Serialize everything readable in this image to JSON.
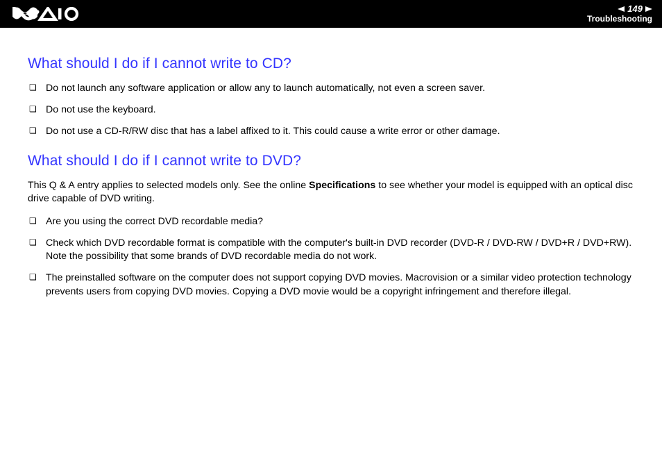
{
  "header": {
    "page_number": "149",
    "section": "Troubleshooting"
  },
  "sections": [
    {
      "heading": "What should I do if I cannot write to CD?",
      "items": [
        "Do not launch any software application or allow any to launch automatically, not even a screen saver.",
        "Do not use the keyboard.",
        "Do not use a CD-R/RW disc that has a label affixed to it. This could cause a write error or other damage."
      ]
    },
    {
      "heading": "What should I do if I cannot write to DVD?",
      "note_pre": "This Q & A entry applies to selected models only. See the online ",
      "note_bold": "Specifications",
      "note_post": " to see whether your model is equipped with an optical disc drive capable of DVD writing.",
      "items": [
        "Are you using the correct DVD recordable media?",
        "Check which DVD recordable format is compatible with the computer's built-in DVD recorder (DVD-R / DVD-RW / DVD+R / DVD+RW). Note the possibility that some brands of DVD recordable media do not work.",
        "The preinstalled software on the computer does not support copying DVD movies. Macrovision or a similar video protection technology prevents users from copying DVD movies. Copying a DVD movie would be a copyright infringement and therefore illegal."
      ]
    }
  ]
}
